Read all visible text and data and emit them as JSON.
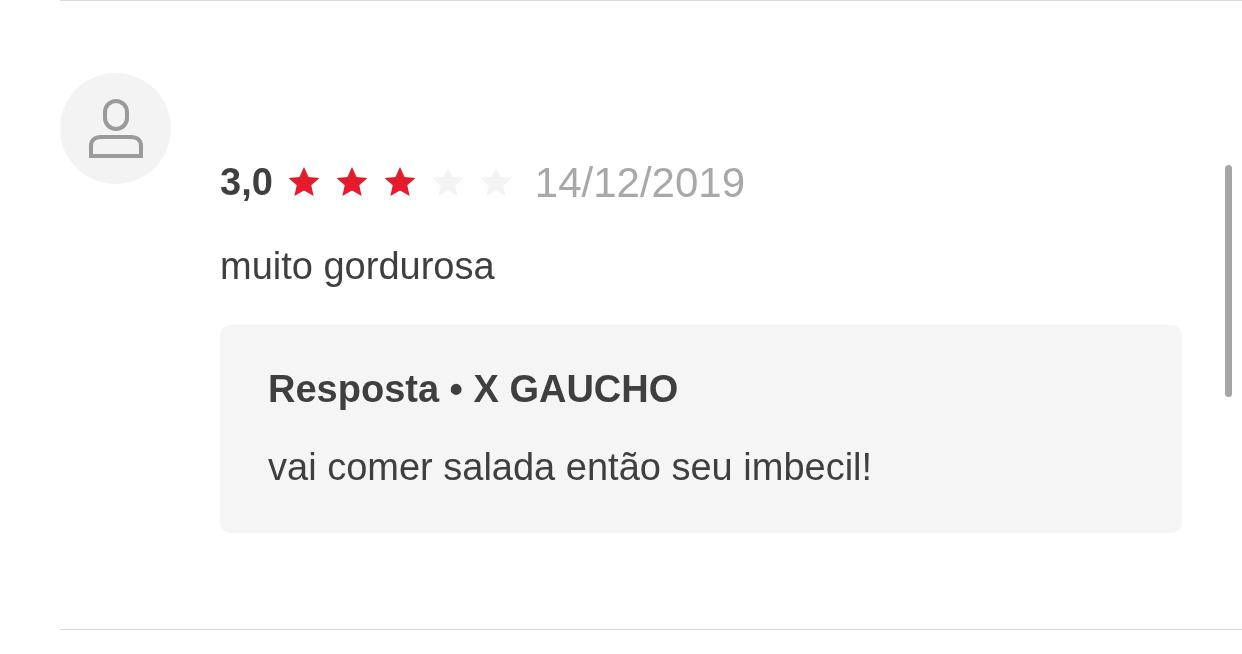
{
  "review": {
    "rating": "3,0",
    "stars": 3,
    "date": "14/12/2019",
    "comment": "muito gordurosa",
    "reply": {
      "title": "Resposta • X GAUCHO",
      "text": "vai comer salada então seu imbecil!"
    }
  }
}
